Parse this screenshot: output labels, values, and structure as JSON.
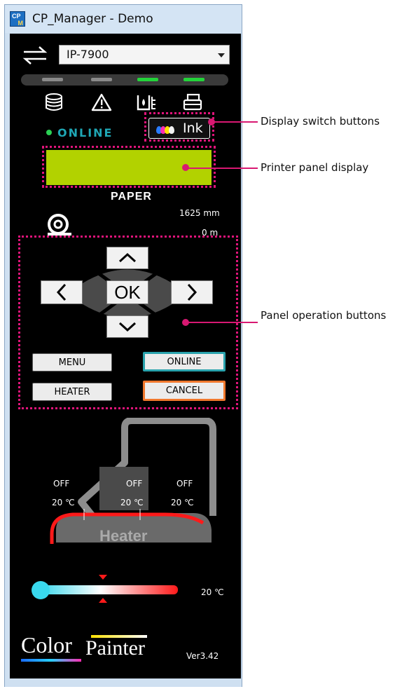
{
  "window": {
    "title": "CP_Manager - Demo",
    "icon_text_top": "CP",
    "icon_text_bottom": "M"
  },
  "printer_select": {
    "value": "IP-7900"
  },
  "status_leds": [
    {
      "name": "led-1",
      "color": "#8a8a8a"
    },
    {
      "name": "led-2",
      "color": "#8a8a8a"
    },
    {
      "name": "led-3",
      "color": "#23d33a"
    },
    {
      "name": "led-4",
      "color": "#23d33a"
    }
  ],
  "status_icons": [
    "media-icon",
    "warning-icon",
    "ink-level-icon",
    "printer-icon"
  ],
  "status": {
    "online_text": "ONLINE",
    "online_color": "#1fa7b5"
  },
  "ink_button": {
    "label": "Ink",
    "drop_colors": [
      "#2a7cff",
      "#ff2db3",
      "#ffe100",
      "#f2f2f2"
    ]
  },
  "lcd": {
    "color": "#b2d200",
    "text": ""
  },
  "paper": {
    "label": "PAPER",
    "width": "1625 mm",
    "length": "0 m"
  },
  "dpad": {
    "ok_label": "OK"
  },
  "operation_buttons": {
    "menu": "MENU",
    "online": "ONLINE",
    "heater": "HEATER",
    "cancel": "CANCEL",
    "online_outline": "#2aa3ad",
    "cancel_outline": "#f0782d"
  },
  "heater": {
    "label": "Heater",
    "zones": [
      {
        "name": "pre-heater",
        "state": "OFF",
        "temp": "20 ℃"
      },
      {
        "name": "print-heater",
        "state": "OFF",
        "temp": "20 ℃"
      },
      {
        "name": "after-heater",
        "state": "OFF",
        "temp": "20 ℃"
      }
    ]
  },
  "temperature_slider": {
    "value_text": "20 ℃"
  },
  "logo_text": {
    "part1": "Color",
    "part2": "Painter"
  },
  "version": "Ver3.42",
  "annotations": {
    "display_switch": "Display switch buttons",
    "panel_display": "Printer panel display",
    "panel_operation": "Panel operation buttons"
  }
}
